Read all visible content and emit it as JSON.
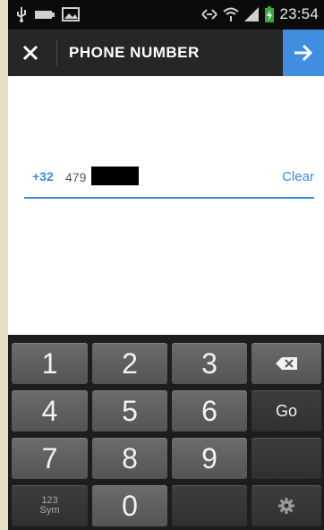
{
  "status_bar": {
    "time": "23:54",
    "icons": [
      "usb-icon",
      "battery-plain-icon",
      "image-icon",
      "nfc-icon",
      "wifi-icon",
      "signal-icon",
      "charging-battery-icon"
    ]
  },
  "app_bar": {
    "title": "PHONE NUMBER",
    "close_icon": "close-icon",
    "next_icon": "arrow-right-icon"
  },
  "phone_field": {
    "country_code": "+32",
    "number_prefix": "479",
    "clear_label": "Clear"
  },
  "keyboard": {
    "rows": [
      [
        "1",
        "2",
        "3",
        "backspace"
      ],
      [
        "4",
        "5",
        "6",
        "Go"
      ],
      [
        "7",
        "8",
        "9",
        ""
      ],
      [
        "123 Sym",
        "0",
        "",
        "settings"
      ]
    ],
    "go_label": "Go",
    "sym_label_top": "123",
    "sym_label_bottom": "Sym",
    "digits": {
      "d1": "1",
      "d2": "2",
      "d3": "3",
      "d4": "4",
      "d5": "5",
      "d6": "6",
      "d7": "7",
      "d8": "8",
      "d9": "9",
      "d0": "0"
    }
  },
  "colors": {
    "accent": "#3a8ee0",
    "next_button": "#3f8ee0",
    "app_bar": "#262626",
    "status_bar": "#0b0b0b",
    "keyboard_bg": "#1d1d1d"
  }
}
